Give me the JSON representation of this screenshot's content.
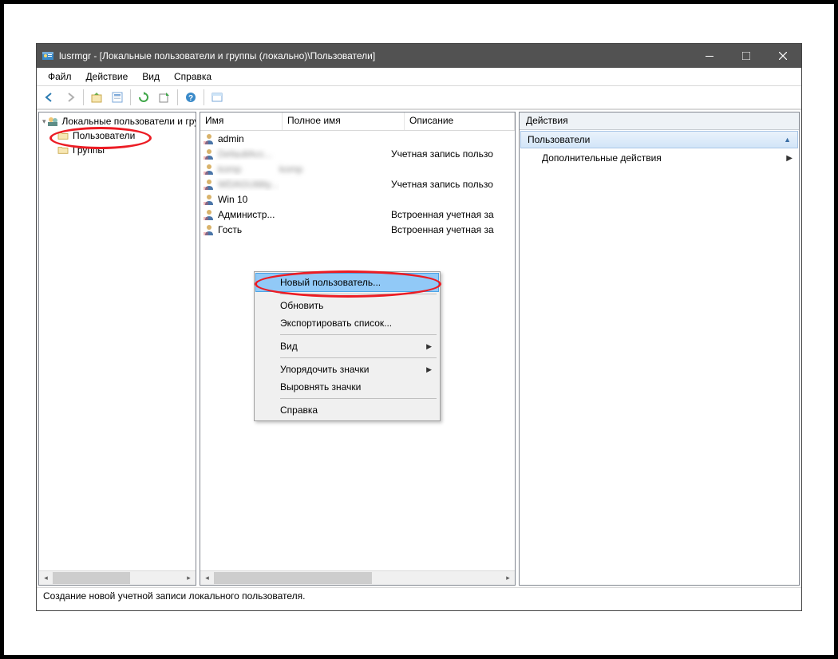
{
  "title": "lusrmgr - [Локальные пользователи и группы (локально)\\Пользователи]",
  "menu": {
    "file": "Файл",
    "action": "Действие",
    "view": "Вид",
    "help": "Справка"
  },
  "tree": {
    "root": "Локальные пользователи и гру",
    "users": "Пользователи",
    "groups": "Группы"
  },
  "cols": {
    "name": "Имя",
    "fullname": "Полное имя",
    "desc": "Описание"
  },
  "rows": [
    {
      "name": "admin",
      "fullname": "",
      "desc": ""
    },
    {
      "name": "DefaultAcc...",
      "fullname": "",
      "desc": "Учетная запись пользо",
      "blur": true
    },
    {
      "name": "komp",
      "fullname": "komp",
      "desc": "",
      "blur": true
    },
    {
      "name": "WDAGUtility...",
      "fullname": "",
      "desc": "Учетная запись пользо",
      "blur": true
    },
    {
      "name": "Win 10",
      "fullname": "",
      "desc": ""
    },
    {
      "name": "Администр...",
      "fullname": "",
      "desc": "Встроенная учетная за"
    },
    {
      "name": "Гость",
      "fullname": "",
      "desc": "Встроенная учетная за"
    }
  ],
  "actions": {
    "header": "Действия",
    "section": "Пользователи",
    "more": "Дополнительные действия"
  },
  "ctx": {
    "newuser": "Новый пользователь...",
    "refresh": "Обновить",
    "export": "Экспортировать список...",
    "view": "Вид",
    "arrange": "Упорядочить значки",
    "align": "Выровнять значки",
    "help": "Справка"
  },
  "status": "Создание новой учетной записи локального пользователя."
}
